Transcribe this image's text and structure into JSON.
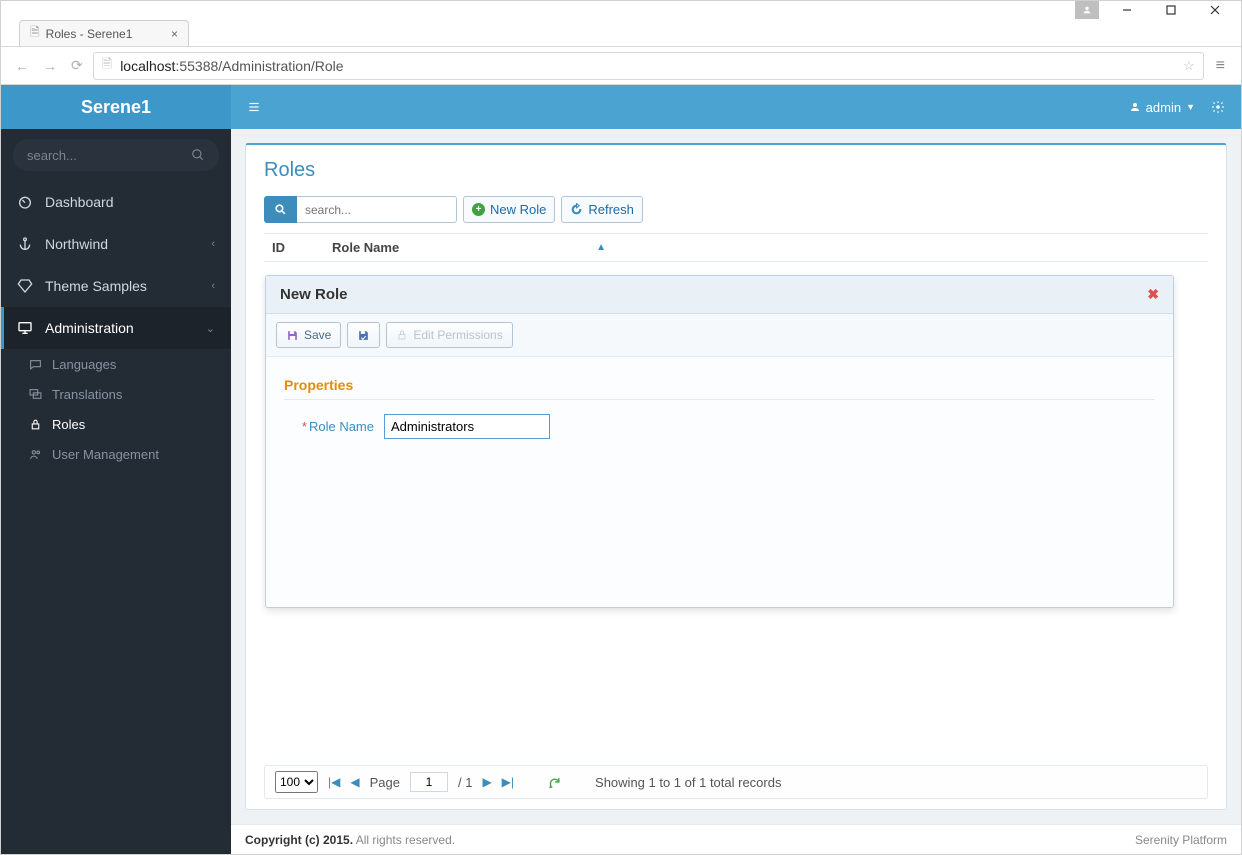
{
  "browser": {
    "tab_title": "Roles - Serene1",
    "url_host": "localhost",
    "url_port": ":55388",
    "url_path": "/Administration/Role"
  },
  "brand": "Serene1",
  "sidebar": {
    "search_placeholder": "search...",
    "items": [
      {
        "label": "Dashboard"
      },
      {
        "label": "Northwind"
      },
      {
        "label": "Theme Samples"
      },
      {
        "label": "Administration"
      }
    ],
    "submenu": [
      {
        "label": "Languages"
      },
      {
        "label": "Translations"
      },
      {
        "label": "Roles"
      },
      {
        "label": "User Management"
      }
    ]
  },
  "topbar": {
    "user": "admin"
  },
  "panel": {
    "title": "Roles",
    "search_placeholder": "search...",
    "new_btn": "New Role",
    "refresh_btn": "Refresh",
    "col_id": "ID",
    "col_name": "Role Name"
  },
  "dialog": {
    "title": "New Role",
    "save": "Save",
    "edit_perms": "Edit Permissions",
    "properties": "Properties",
    "role_name_label": "Role Name",
    "role_name_value": "Administrators"
  },
  "pager": {
    "page_size": "100",
    "page_label": "Page",
    "page_current": "1",
    "page_total": "/ 1",
    "summary": "Showing 1 to 1 of 1 total records"
  },
  "footer": {
    "copy_bold": "Copyright (c) 2015.",
    "copy_rest": " All rights reserved.",
    "platform": "Serenity Platform"
  }
}
